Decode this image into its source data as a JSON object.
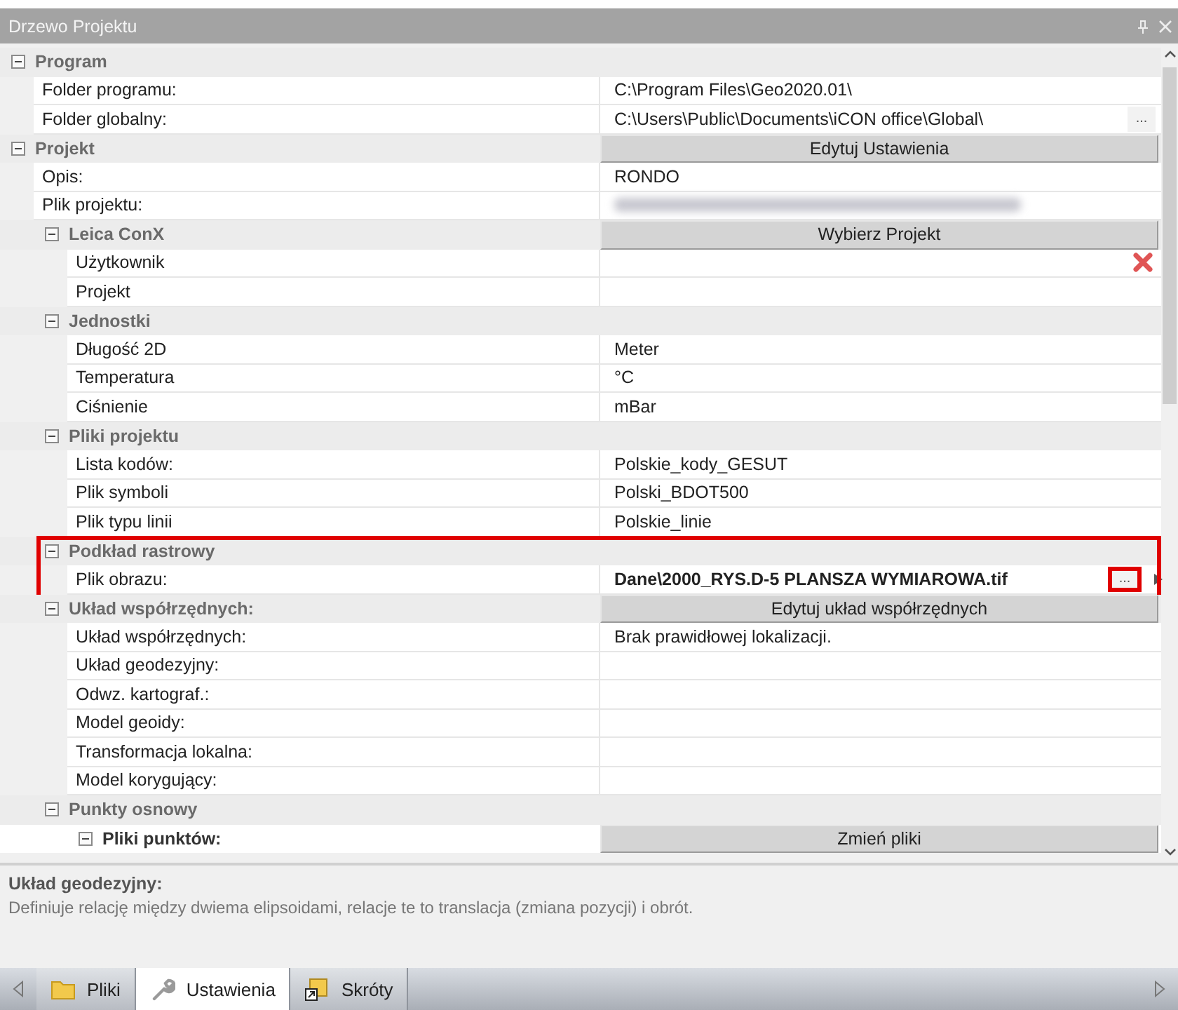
{
  "window": {
    "title": "Drzewo Projektu"
  },
  "tree": [
    {
      "kind": "group",
      "label": "Program",
      "expanded": true,
      "children": [
        {
          "kind": "property",
          "label": "Folder programu:",
          "value": "C:\\Program Files\\Geo2020.01\\"
        },
        {
          "kind": "property",
          "label": "Folder globalny:",
          "value": "C:\\Users\\Public\\Documents\\iCON office\\Global\\",
          "browse": "..."
        }
      ]
    },
    {
      "kind": "group",
      "label": "Projekt",
      "expanded": true,
      "button": "Edytuj Ustawienia",
      "children": [
        {
          "kind": "property",
          "label": "Opis:",
          "value": "RONDO"
        },
        {
          "kind": "property",
          "label": "Plik projektu:",
          "redacted": true
        },
        {
          "kind": "group",
          "label": "Leica ConX",
          "expanded": true,
          "button": "Wybierz Projekt",
          "children": [
            {
              "kind": "property",
              "label": "Użytkownik",
              "deletable": true
            },
            {
              "kind": "property",
              "label": "Projekt"
            }
          ]
        },
        {
          "kind": "group",
          "label": "Jednostki",
          "expanded": true,
          "children": [
            {
              "kind": "property",
              "label": "Długość 2D",
              "value": "Meter"
            },
            {
              "kind": "property",
              "label": "Temperatura",
              "value": "°C"
            },
            {
              "kind": "property",
              "label": "Ciśnienie",
              "value": "mBar"
            }
          ]
        },
        {
          "kind": "group",
          "label": "Pliki projektu",
          "expanded": true,
          "children": [
            {
              "kind": "property",
              "label": "Lista kodów:",
              "value": "Polskie_kody_GESUT"
            },
            {
              "kind": "property",
              "label": "Plik symboli",
              "value": "Polski_BDOT500"
            },
            {
              "kind": "property",
              "label": "Plik typu linii",
              "value": "Polskie_linie"
            }
          ]
        },
        {
          "kind": "group",
          "label": "Podkład rastrowy",
          "expanded": true,
          "highlighted": true,
          "children": [
            {
              "kind": "property",
              "label": "Plik obrazu:",
              "value": "Dane\\2000_RYS.D-5 PLANSZA WYMIAROWA.tif",
              "bold": true,
              "browse": "...",
              "browse_highlighted": true,
              "more": true
            }
          ]
        },
        {
          "kind": "group",
          "label": "Układ współrzędnych:",
          "expanded": true,
          "button": "Edytuj układ współrzędnych",
          "children": [
            {
              "kind": "property",
              "label": "Układ współrzędnych:",
              "value": "Brak prawidłowej lokalizacji."
            },
            {
              "kind": "property",
              "label": "Układ geodezyjny:"
            },
            {
              "kind": "property",
              "label": "Odwz. kartograf.:"
            },
            {
              "kind": "property",
              "label": "Model geoidy:"
            },
            {
              "kind": "property",
              "label": "Transformacja lokalna:"
            },
            {
              "kind": "property",
              "label": "Model korygujący:"
            }
          ]
        },
        {
          "kind": "group",
          "label": "Punkty osnowy",
          "expanded": true,
          "children": [
            {
              "kind": "subgroup",
              "label": "Pliki punktów:",
              "expanded": true,
              "button": "Zmień pliki"
            }
          ]
        }
      ]
    }
  ],
  "description": {
    "title": "Układ geodezyjny:",
    "text": "Definiuje relację między dwiema elipsoidami, relacje te to translacja (zmiana pozycji) i obrót."
  },
  "tabs": [
    {
      "label": "Pliki",
      "selected": false
    },
    {
      "label": "Ustawienia",
      "selected": true
    },
    {
      "label": "Skróty",
      "selected": false
    }
  ]
}
